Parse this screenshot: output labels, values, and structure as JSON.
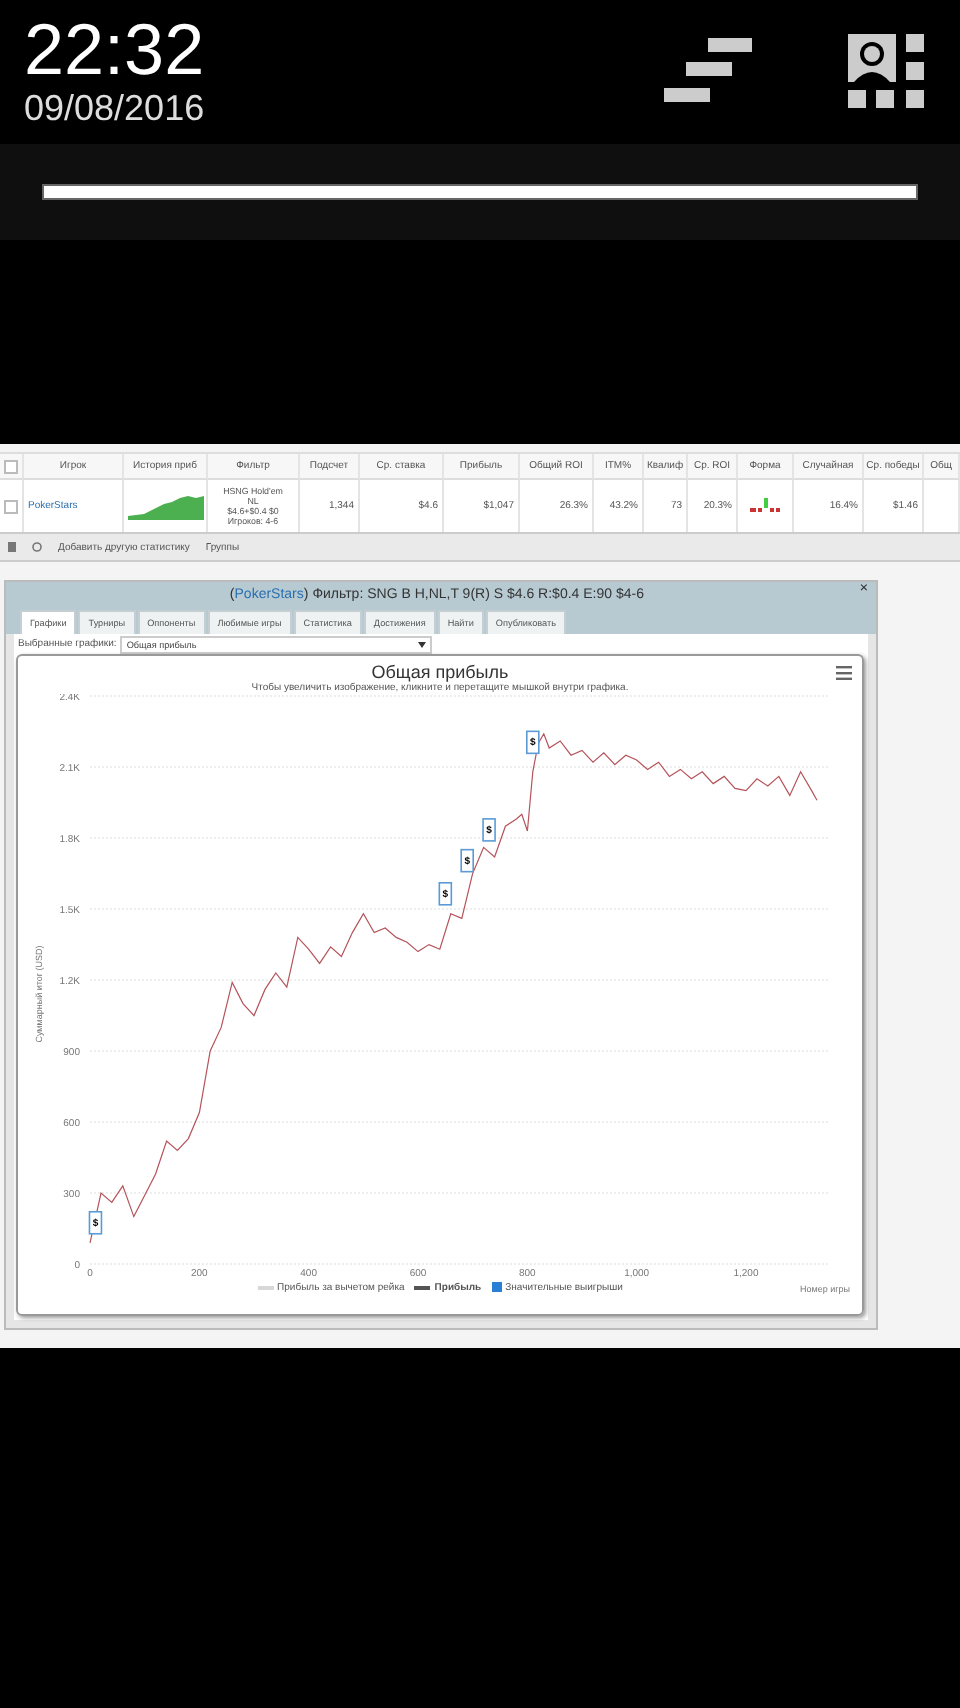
{
  "status": {
    "time": "22:32",
    "date": "09/08/2016"
  },
  "seek_bar": {
    "level": 1
  },
  "table": {
    "all_selected": false,
    "columns": [
      "Игрок",
      "История приб",
      "Фильтр",
      "Подсчет",
      "Ср. ставка",
      "Прибыль",
      "Общий ROI",
      "ITM%",
      "Квалиф",
      "Ср. ROI",
      "Форма",
      "Случайная",
      "Ср. победы",
      "Общ"
    ],
    "rows": [
      {
        "selected": false,
        "player": "PokerStars",
        "filter": [
          "HSNG Hold'em",
          "NL",
          "$4.6+$0.4 $0",
          "Игроков: 4-6"
        ],
        "count": "1,344",
        "avg_stake": "$4.6",
        "profit": "$1,047",
        "roi": "26.3%",
        "itm": "43.2%",
        "qualif": "73",
        "avg_roi": "20.3%",
        "random": "16.4%",
        "avg_win": "$1.46"
      }
    ]
  },
  "toolbar": {
    "add_stats": "Добавить другую статистику",
    "groups": "Группы"
  },
  "window": {
    "title_open": "(",
    "title_site": "PokerStars",
    "title_close": ")",
    "title_rest": "Фильтр: SNG B H,NL,T 9(R) S $4.6 R:$0.4 E:90 $4-6",
    "close": "×",
    "tabs": [
      {
        "label": "Графики",
        "selected": true
      },
      {
        "label": "Турниры",
        "selected": false
      },
      {
        "label": "Оппоненты",
        "selected": false
      },
      {
        "label": "Любимые игры",
        "selected": false
      },
      {
        "label": "Статистика",
        "selected": false
      },
      {
        "label": "Достижения",
        "selected": false
      },
      {
        "label": "Найти",
        "selected": false
      },
      {
        "label": "Опубликовать",
        "selected": false
      }
    ],
    "graph_select": {
      "label": "Выбранные графики:",
      "value": "Общая прибыль"
    }
  },
  "chart": {
    "legend": [
      {
        "kind": "line",
        "label": "Прибыль за вычетом рейка",
        "color": "#d8d8d8",
        "bold": false
      },
      {
        "kind": "series",
        "color": "#555555",
        "bold": true
      },
      {
        "kind": "square",
        "label": "Значительные выигрыши",
        "color": "#2a7fd4",
        "bold": false
      }
    ],
    "markers": [
      {
        "label": "$"
      },
      {
        "label": "$"
      },
      {
        "label": "$"
      },
      {
        "label": "$"
      },
      {
        "label": "$"
      }
    ],
    "chart_data": {
      "type": "line",
      "title": "Общая прибыль",
      "subtitle": "Чтобы увеличить изображение, кликните и перетащите мышкой внутри графика.",
      "xlabel": "Номер игры",
      "ylabel": "Суммарный итог (USD)",
      "x": [
        0,
        20,
        40,
        60,
        80,
        100,
        120,
        140,
        160,
        180,
        200,
        220,
        240,
        260,
        280,
        300,
        320,
        340,
        360,
        380,
        400,
        420,
        440,
        460,
        480,
        500,
        520,
        540,
        560,
        580,
        600,
        620,
        640,
        660,
        680,
        700,
        720,
        740,
        760,
        780,
        790,
        800,
        810,
        820,
        830,
        840,
        860,
        880,
        900,
        920,
        940,
        960,
        980,
        1000,
        1020,
        1040,
        1060,
        1080,
        1100,
        1120,
        1140,
        1160,
        1180,
        1200,
        1220,
        1240,
        1260,
        1280,
        1300,
        1320,
        1330
      ],
      "series": [
        {
          "name": "Прибыль",
          "color": "#b5525a",
          "values": [
            90,
            300,
            260,
            330,
            200,
            290,
            380,
            520,
            480,
            530,
            640,
            900,
            1000,
            1190,
            1100,
            1050,
            1160,
            1230,
            1170,
            1380,
            1330,
            1270,
            1340,
            1300,
            1400,
            1480,
            1400,
            1420,
            1380,
            1360,
            1320,
            1350,
            1330,
            1480,
            1460,
            1650,
            1760,
            1720,
            1850,
            1880,
            1900,
            1830,
            2080,
            2200,
            2240,
            2180,
            2210,
            2150,
            2170,
            2120,
            2160,
            2110,
            2150,
            2130,
            2090,
            2120,
            2060,
            2090,
            2050,
            2080,
            2030,
            2060,
            2010,
            2000,
            2050,
            2020,
            2060,
            1980,
            2080,
            2000,
            1960
          ]
        }
      ],
      "xlim": [
        0,
        1350
      ],
      "ylim": [
        0,
        2400
      ],
      "grid": true,
      "xticks": [
        {
          "value": 0,
          "label": "0"
        },
        {
          "value": 200,
          "label": "200"
        },
        {
          "value": 400,
          "label": "400"
        },
        {
          "value": 600,
          "label": "600"
        },
        {
          "value": 800,
          "label": "800"
        },
        {
          "value": 1000,
          "label": "1,000"
        },
        {
          "value": 1200,
          "label": "1,200"
        }
      ],
      "yticks": [
        {
          "value": 2400,
          "label": "2.4K"
        },
        {
          "value": 2100,
          "label": "2.1K"
        },
        {
          "value": 1800,
          "label": "1.8K"
        },
        {
          "value": 1500,
          "label": "1.5K"
        },
        {
          "value": 1200,
          "label": "1.2K"
        },
        {
          "value": 900,
          "label": "900"
        },
        {
          "value": 600,
          "label": "600"
        },
        {
          "value": 300,
          "label": "300"
        },
        {
          "value": 0,
          "label": "0"
        }
      ]
    }
  }
}
